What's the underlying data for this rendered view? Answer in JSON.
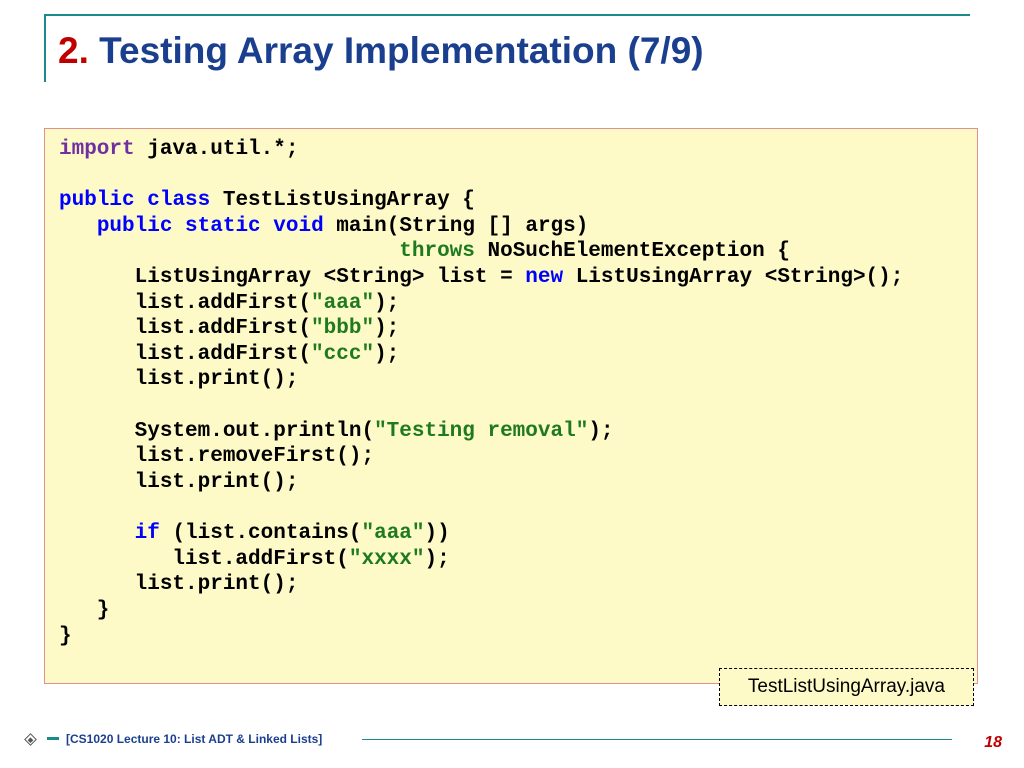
{
  "title": {
    "number": "2.",
    "text": " Testing Array Implementation (7/9)"
  },
  "file_label": "TestListUsingArray.java",
  "footer": {
    "text": "[CS1020 Lecture 10: List ADT & Linked Lists]",
    "page": "18"
  },
  "code": {
    "kw_import": "import",
    "pkg": " java.util.*;",
    "kw_public1": "public",
    "kw_class": "class",
    "classname": " TestListUsingArray {",
    "indent1": "   ",
    "kw_public2": "public",
    "kw_static": "static",
    "kw_void": "void",
    "main_sig": " main(String [] args)",
    "throws_pad": "                           ",
    "kw_throws": "throws",
    "exc": " NoSuchElementException {",
    "decl_pre": "      ListUsingArray <String> list = ",
    "kw_new": "new",
    "decl_post": " ListUsingArray <String>();",
    "add1_pre": "      list.addFirst(",
    "add1_str": "\"aaa\"",
    "add1_post": ");",
    "add2_pre": "      list.addFirst(",
    "add2_str": "\"bbb\"",
    "add2_post": ");",
    "add3_pre": "      list.addFirst(",
    "add3_str": "\"ccc\"",
    "add3_post": ");",
    "print1": "      list.print();",
    "sys_pre": "      System.out.println(",
    "sys_str": "\"Testing removal\"",
    "sys_post": ");",
    "remove": "      list.removeFirst();",
    "print2": "      list.print();",
    "if_pad": "      ",
    "kw_if": "if",
    "if_cond_pre": " (list.contains(",
    "if_str": "\"aaa\"",
    "if_cond_post": "))",
    "addx_pre": "         list.addFirst(",
    "addx_str": "\"xxxx\"",
    "addx_post": ");",
    "print3": "      list.print();",
    "close1": "   }",
    "close2": "}"
  }
}
